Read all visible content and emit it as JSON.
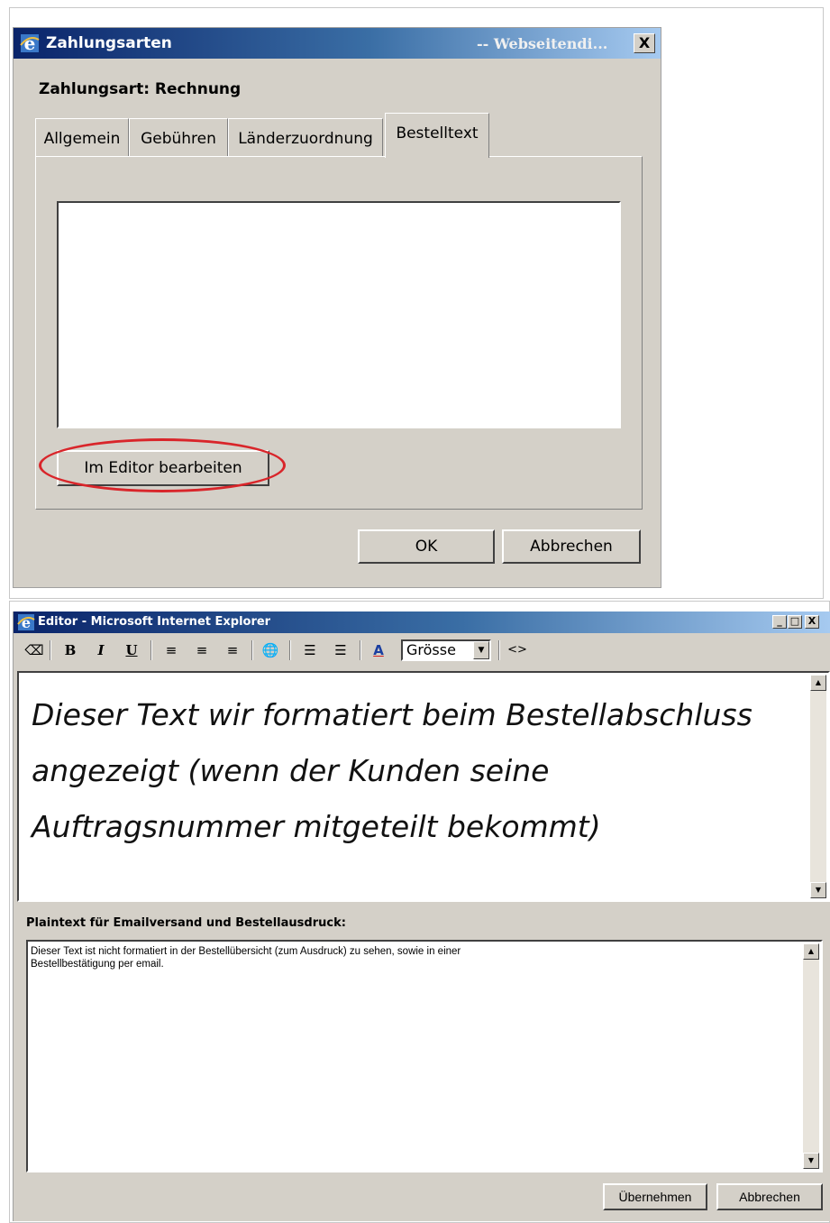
{
  "dialog1": {
    "title": "Zahlungsarten",
    "title_right": "-- Webseitendi...",
    "close_label": "X",
    "subtitle": "Zahlungsart: Rechnung",
    "tabs": [
      {
        "label": "Allgemein"
      },
      {
        "label": "Gebühren"
      },
      {
        "label": "Länderzuordnung"
      },
      {
        "label": "Bestelltext"
      }
    ],
    "active_tab": "Bestelltext",
    "edit_button": "Im Editor bearbeiten",
    "ok_button": "OK",
    "cancel_button": "Abbrechen"
  },
  "editor_window": {
    "title": "Editor - Microsoft Internet Explorer",
    "window_controls": [
      "_",
      "□",
      "X"
    ],
    "toolbar": {
      "eraser": "⌫",
      "bold": "B",
      "italic": "I",
      "underline": "U",
      "align_left": "≡",
      "align_center": "≡",
      "align_right": "≡",
      "link": "🌐",
      "unordered_list": "☰",
      "ordered_list": "☰",
      "font_color": "A",
      "size_select": "Grösse",
      "source": "<>"
    },
    "rich_text": "Dieser Text wir formatiert beim Bestellabschluss angezeigt (wenn der Kunden seine Auftragsnummer mitgeteilt bekommt)",
    "plaintext_label": "Plaintext für Emailversand und Bestellausdruck:",
    "plaintext": "Dieser Text ist nicht formatiert in der Bestellübersicht (zum Ausdruck) zu sehen, sowie in einer\nBestellbestätigung per email.",
    "apply_button": "Übernehmen",
    "cancel_button": "Abbrechen"
  },
  "colors": {
    "titlebar_start": "#0a246a",
    "titlebar_end": "#a6caf0",
    "dialog_bg": "#d4d0c8",
    "highlight_ellipse": "#d9252a"
  }
}
